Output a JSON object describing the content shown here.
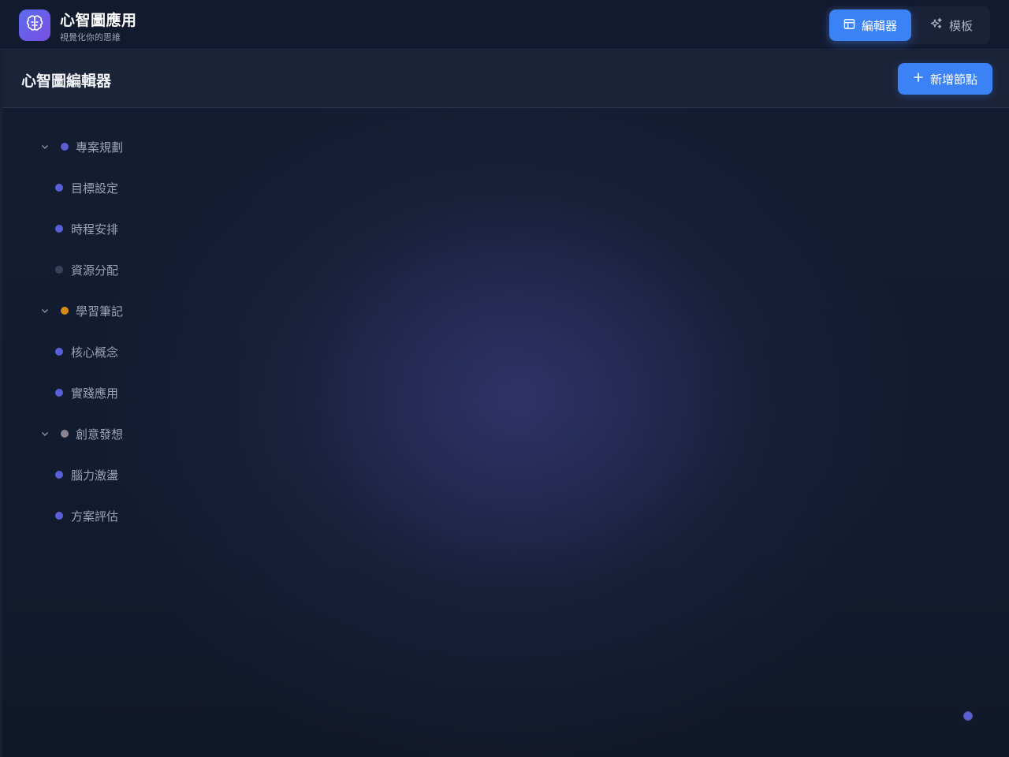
{
  "app": {
    "title": "心智圖應用",
    "subtitle": "視覺化你的思維",
    "logo_icon": "brain-icon"
  },
  "nav_tabs": [
    {
      "label": "編輯器",
      "icon": "layout-icon",
      "active": true
    },
    {
      "label": "模板",
      "icon": "sparkles-icon",
      "active": false
    }
  ],
  "editor": {
    "title": "心智圖編輯器",
    "add_node_label": "新增節點",
    "add_icon": "plus-icon"
  },
  "tree": [
    {
      "label": "專案規劃",
      "color": "#5b5fd6",
      "expanded": true,
      "children": [
        {
          "label": "目標設定",
          "color": "#5b5fd6"
        },
        {
          "label": "時程安排",
          "color": "#5b5fd6"
        },
        {
          "label": "資源分配",
          "color": "#3a4158"
        }
      ]
    },
    {
      "label": "學習筆記",
      "color": "#d98a14",
      "expanded": true,
      "children": [
        {
          "label": "核心概念",
          "color": "#5b5fd6"
        },
        {
          "label": "實踐應用",
          "color": "#5b5fd6"
        }
      ]
    },
    {
      "label": "創意發想",
      "color": "#8a8590",
      "expanded": true,
      "children": [
        {
          "label": "腦力激盪",
          "color": "#5b5fd6"
        },
        {
          "label": "方案評估",
          "color": "#5b5fd6"
        }
      ]
    }
  ],
  "colors": {
    "accent": "#3b82f6",
    "background": "#121a2e"
  }
}
